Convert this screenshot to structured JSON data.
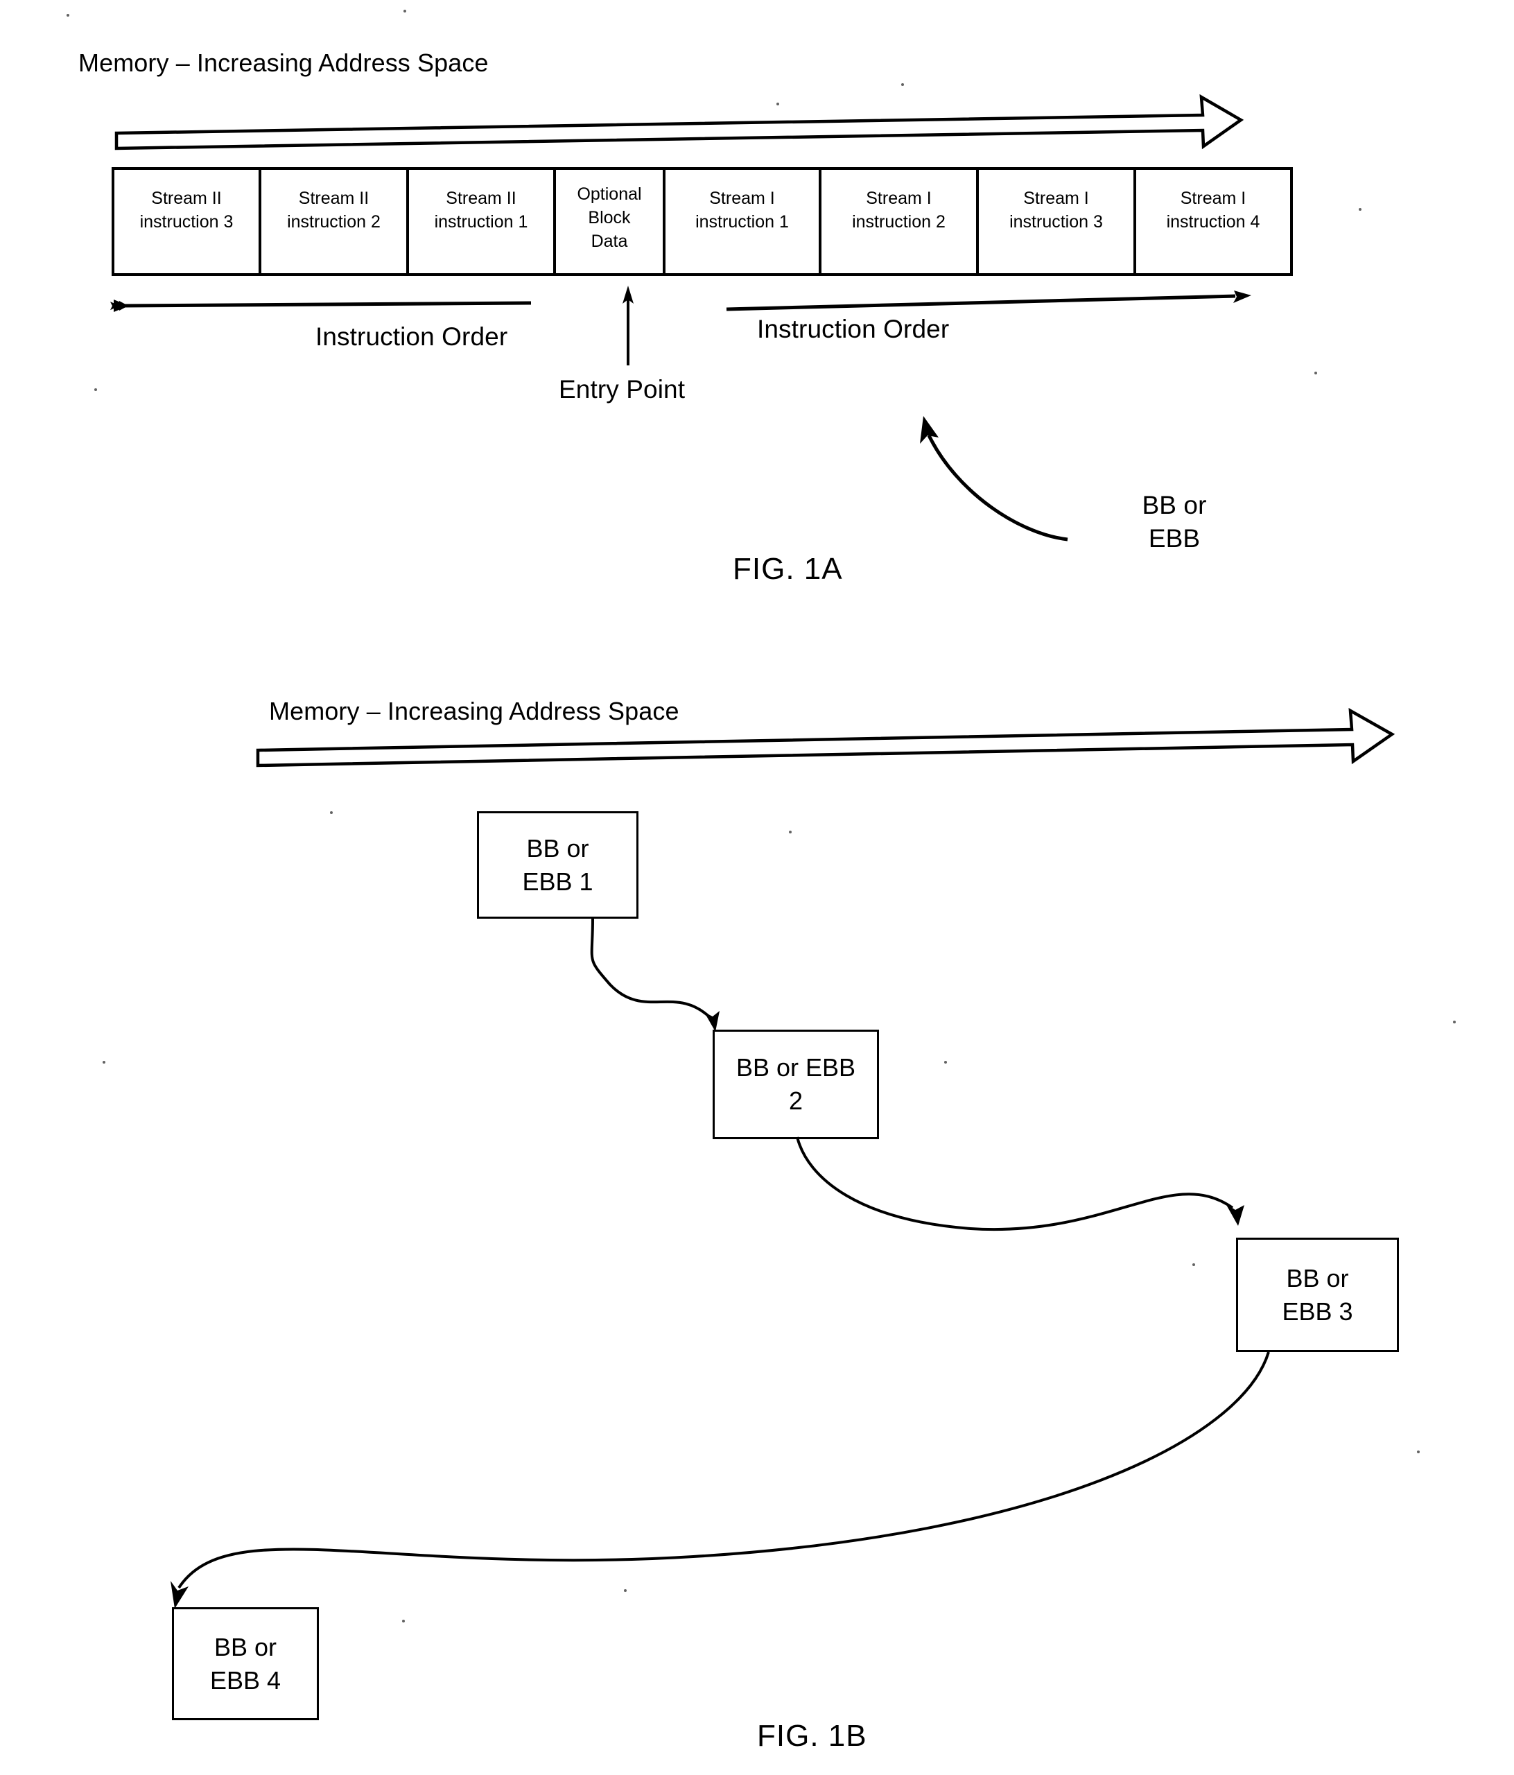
{
  "document": {
    "type": "patent-drawing-sheet",
    "figures": [
      "FIG. 1A",
      "FIG. 1B"
    ]
  },
  "fig1a": {
    "caption": "FIG. 1A",
    "memory_axis_label": "Memory – Increasing Address Space",
    "cells": [
      {
        "line1": "Stream II",
        "line2": "instruction 3"
      },
      {
        "line1": "Stream II",
        "line2": "instruction 2"
      },
      {
        "line1": "Stream II",
        "line2": "instruction 1"
      },
      {
        "line1": "Optional",
        "line2": "Block",
        "line3": "Data"
      },
      {
        "line1": "Stream I",
        "line2": "instruction 1"
      },
      {
        "line1": "Stream I",
        "line2": "instruction 2"
      },
      {
        "line1": "Stream I",
        "line2": "instruction 3"
      },
      {
        "line1": "Stream I",
        "line2": "instruction 4"
      }
    ],
    "left_order_label": "Instruction Order",
    "right_order_label": "Instruction Order",
    "entry_point_label": "Entry Point",
    "callout_line1": "BB or",
    "callout_line2": "EBB"
  },
  "fig1b": {
    "caption": "FIG. 1B",
    "memory_axis_label": "Memory – Increasing Address Space",
    "blocks": [
      {
        "line1": "BB or",
        "line2": "EBB 1"
      },
      {
        "line1": "BB or EBB",
        "line2": "2"
      },
      {
        "line1": "BB or",
        "line2": "EBB 3"
      },
      {
        "line1": "BB or",
        "line2": "EBB 4"
      }
    ]
  },
  "colors": {
    "ink": "#000000",
    "paper": "#ffffff"
  }
}
